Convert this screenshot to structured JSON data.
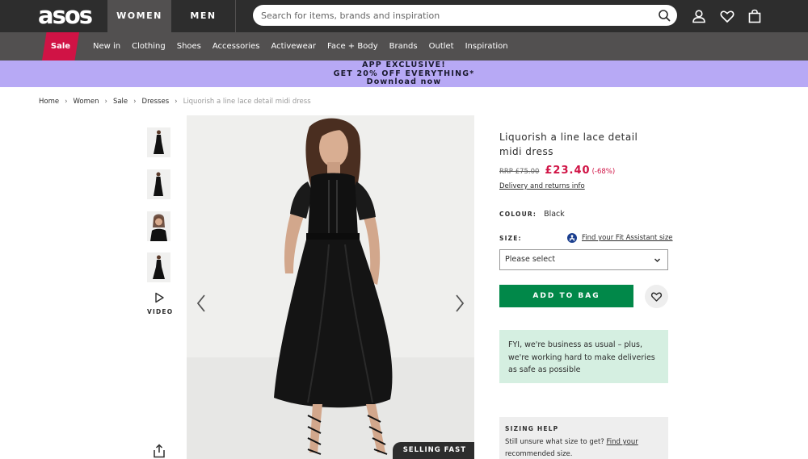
{
  "header": {
    "logo": "asos",
    "tabs": [
      "WOMEN",
      "MEN"
    ],
    "search_placeholder": "Search for items, brands and inspiration",
    "icons": [
      "search-icon",
      "account-icon",
      "heart-icon",
      "bag-icon"
    ]
  },
  "nav": {
    "sale": "Sale",
    "items": [
      "New in",
      "Clothing",
      "Shoes",
      "Accessories",
      "Activewear",
      "Face + Body",
      "Brands",
      "Outlet",
      "Inspiration"
    ]
  },
  "promo": {
    "line1": "APP EXCLUSIVE!",
    "line2": "GET 20% OFF EVERYTHING*",
    "line3": "Download now"
  },
  "breadcrumb": [
    "Home",
    "Women",
    "Sale",
    "Dresses",
    "Liquorish a line lace detail midi dress"
  ],
  "gallery": {
    "video_label": "VIDEO",
    "badge": "SELLING FAST"
  },
  "product": {
    "title": "Liquorish a line lace detail midi dress",
    "rrp": "RRP £75.00",
    "price": "£23.40",
    "discount": "(-68%)",
    "delivery_link": "Delivery and returns info",
    "colour_label": "COLOUR:",
    "colour_value": "Black",
    "size_label": "SIZE:",
    "fit_assistant": "Find your Fit Assistant size",
    "size_placeholder": "Please select",
    "add_to_bag": "ADD TO BAG",
    "notice": "FYI, we're business as usual – plus, we're working hard to make deliveries as safe as possible",
    "sizing_help_title": "SIZING HELP",
    "sizing_help_text": "Still unsure what size to get?",
    "sizing_help_link": "Find your",
    "sizing_help_text2": "recommended size."
  },
  "colors": {
    "header_bg": "#2d2d2d",
    "nav_bg": "#525050",
    "sale_red": "#d01345",
    "promo_bg": "#b7a9f5",
    "add_to_bag_green": "#018849",
    "notice_bg": "#d5efe1"
  }
}
